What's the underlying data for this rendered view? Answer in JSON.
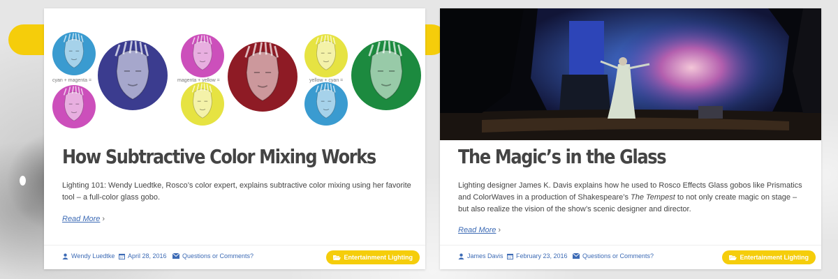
{
  "colors": {
    "accent": "#f5cd0b",
    "link": "#3d6bb5",
    "title": "#444444"
  },
  "posts": [
    {
      "title": "How Subtractive Color Mixing Works",
      "excerpt": "Lighting 101: Wendy Luedtke, Rosco’s color expert, explains subtractive color mixing using her favorite tool – a full-color glass gobo.",
      "read_more": "Read More",
      "author": "Wendy Luedtke",
      "date": "April 28, 2016",
      "comments": "Questions or Comments?",
      "category": "Entertainment Lighting",
      "image_captions": [
        "cyan + magenta =",
        "magenta + yellow =",
        "yellow + cyan ="
      ]
    },
    {
      "title": "The Magic’s in the Glass",
      "excerpt_pre": "Lighting designer James K. Davis explains how he used to Rosco Effects Glass gobos like Prismatics and ColorWaves in a production of Shakespeare’s ",
      "excerpt_em": "The Tempest",
      "excerpt_post": " to not only create magic on stage – but also realize the vision of the show’s scenic designer and director.",
      "read_more": "Read More",
      "author": "James Davis",
      "date": "February 23, 2016",
      "comments": "Questions or Comments?",
      "category": "Entertainment Lighting"
    }
  ],
  "icons": [
    "user-icon",
    "calendar-icon",
    "envelope-icon",
    "folder-open-icon",
    "chevron-right-icon"
  ]
}
